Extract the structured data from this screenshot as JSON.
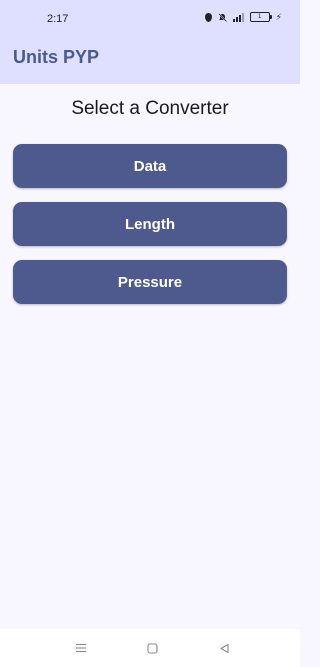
{
  "status_bar": {
    "time": "2:17",
    "battery_level": "1"
  },
  "app_bar": {
    "title": "Units PYP"
  },
  "main": {
    "heading": "Select a Converter",
    "buttons": [
      {
        "label": "Data"
      },
      {
        "label": "Length"
      },
      {
        "label": "Pressure"
      }
    ]
  },
  "nav_bar": {
    "items": [
      {
        "icon": "menu-icon"
      },
      {
        "icon": "home-square-icon"
      },
      {
        "icon": "back-triangle-icon"
      }
    ]
  },
  "colors": {
    "app_bar_background": "#dfe0ff",
    "title": "#4b5a8e",
    "button_background": "#4e5a8d",
    "button_text": "#ffffff",
    "page_background": "#f8f6ff"
  }
}
